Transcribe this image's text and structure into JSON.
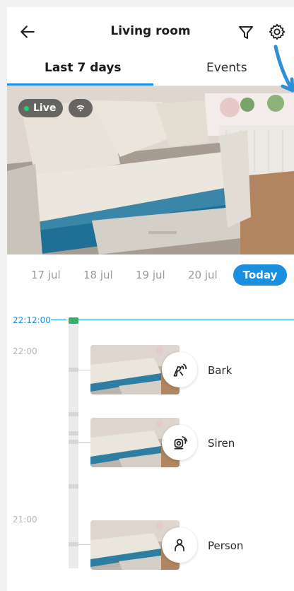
{
  "header": {
    "title": "Living room",
    "back_icon": "arrow-left-icon",
    "filter_icon": "filter-icon",
    "settings_icon": "gear-icon"
  },
  "tabs": [
    {
      "label": "Last 7 days",
      "active": true
    },
    {
      "label": "Events",
      "active": false
    }
  ],
  "camera": {
    "live_label": "Live",
    "signal_icon": "wifi-icon"
  },
  "dates": [
    {
      "label": "17 jul"
    },
    {
      "label": "18 jul"
    },
    {
      "label": "19 jul"
    },
    {
      "label": "20 jul"
    },
    {
      "label": "Today",
      "selected": true
    }
  ],
  "timeline": {
    "current_time": "22:12:00",
    "hour_labels": [
      "22:00",
      "21:00"
    ],
    "events": [
      {
        "label": "Bark",
        "icon": "dog-bark-icon"
      },
      {
        "label": "Siren",
        "icon": "siren-icon"
      },
      {
        "label": "Person",
        "icon": "person-icon"
      }
    ]
  },
  "colors": {
    "accent": "#1a8fe0",
    "live_dot": "#2ecc71",
    "now_marker": "#2db36b"
  }
}
